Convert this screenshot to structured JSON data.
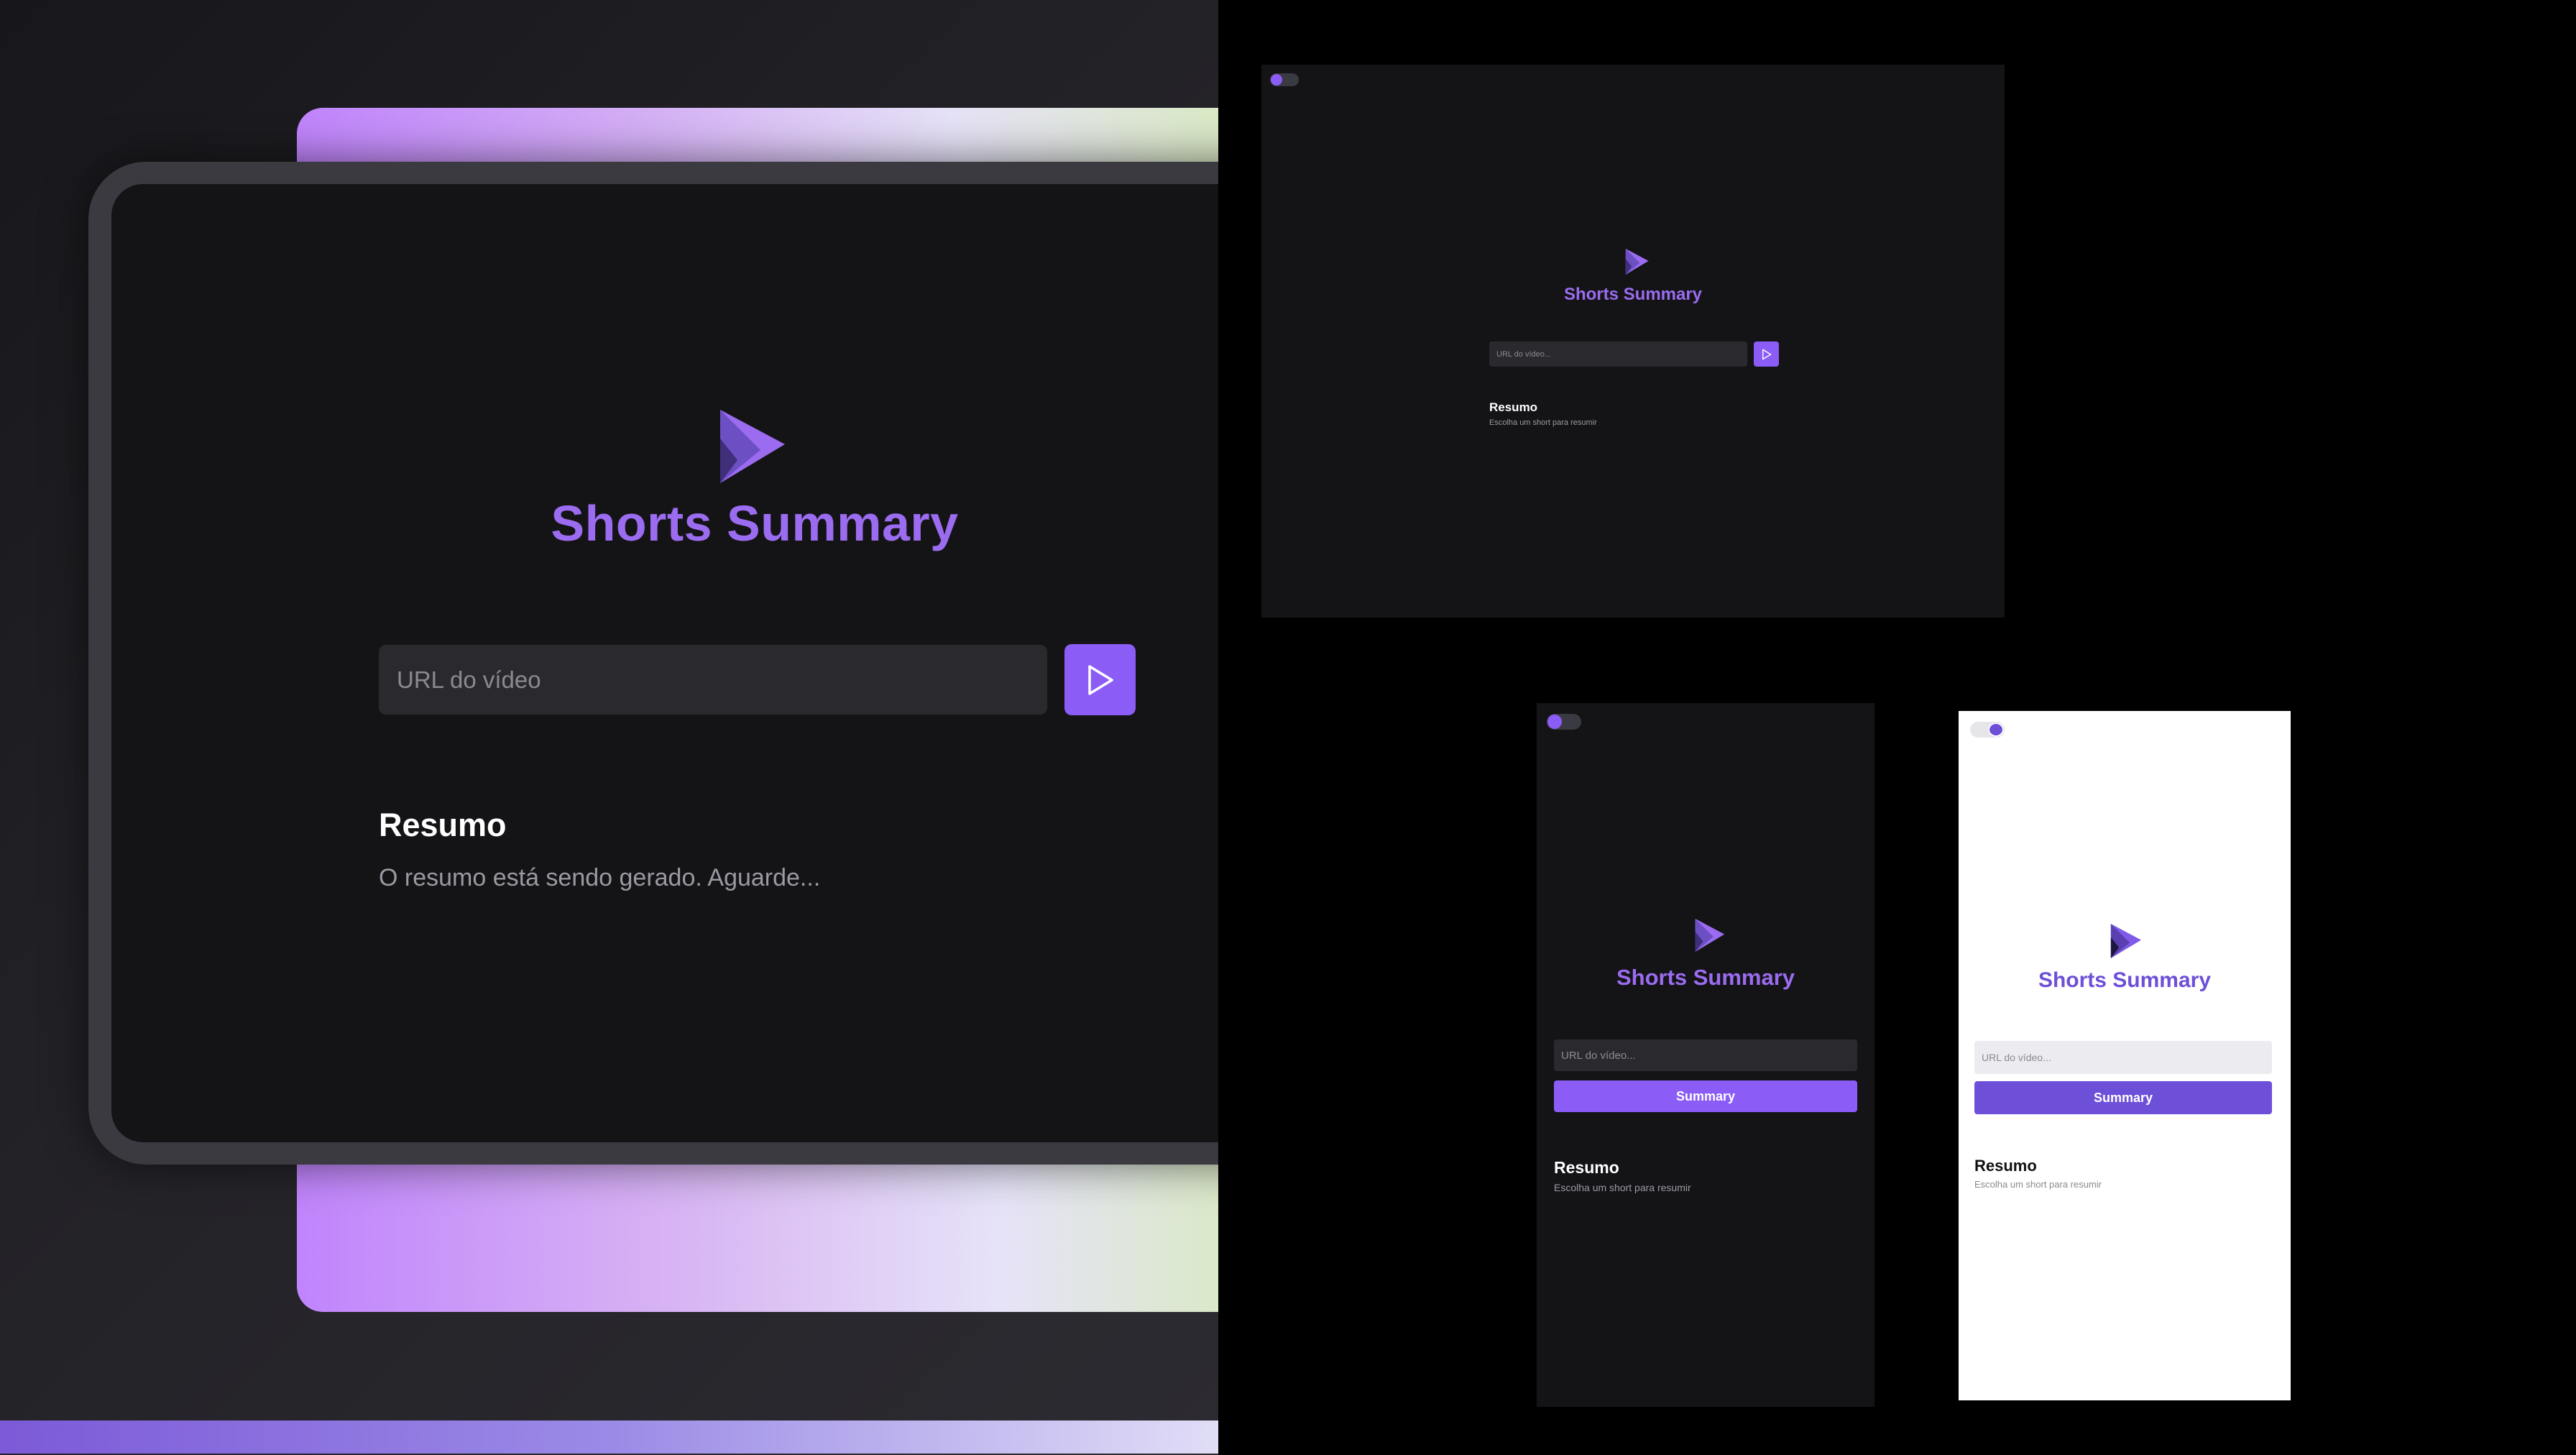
{
  "app": {
    "title": "Shorts Summary",
    "accent_color": "#8b5cf6",
    "accent_light_color": "#6d4fd8"
  },
  "hero": {
    "logo_icon": "play-triangle-logo",
    "title": "Shorts Summary",
    "url_placeholder": "URL do vídeo",
    "submit_icon": "play-icon",
    "summary_heading": "Resumo",
    "summary_text": "O resumo está sendo gerado. Aguarde..."
  },
  "desktop_preview": {
    "title": "Shorts Summary",
    "url_placeholder": "URL do vídeo...",
    "summary_heading": "Resumo",
    "summary_text": "Escolha um short para resumir"
  },
  "mobile_dark_preview": {
    "title": "Shorts Summary",
    "url_placeholder": "URL do vídeo...",
    "button_label": "Summary",
    "summary_heading": "Resumo",
    "summary_text": "Escolha um short para resumir"
  },
  "mobile_light_preview": {
    "title": "Shorts Summary",
    "url_placeholder": "URL do vídeo...",
    "button_label": "Summary",
    "summary_heading": "Resumo",
    "summary_text": "Escolha um short para resumir"
  }
}
